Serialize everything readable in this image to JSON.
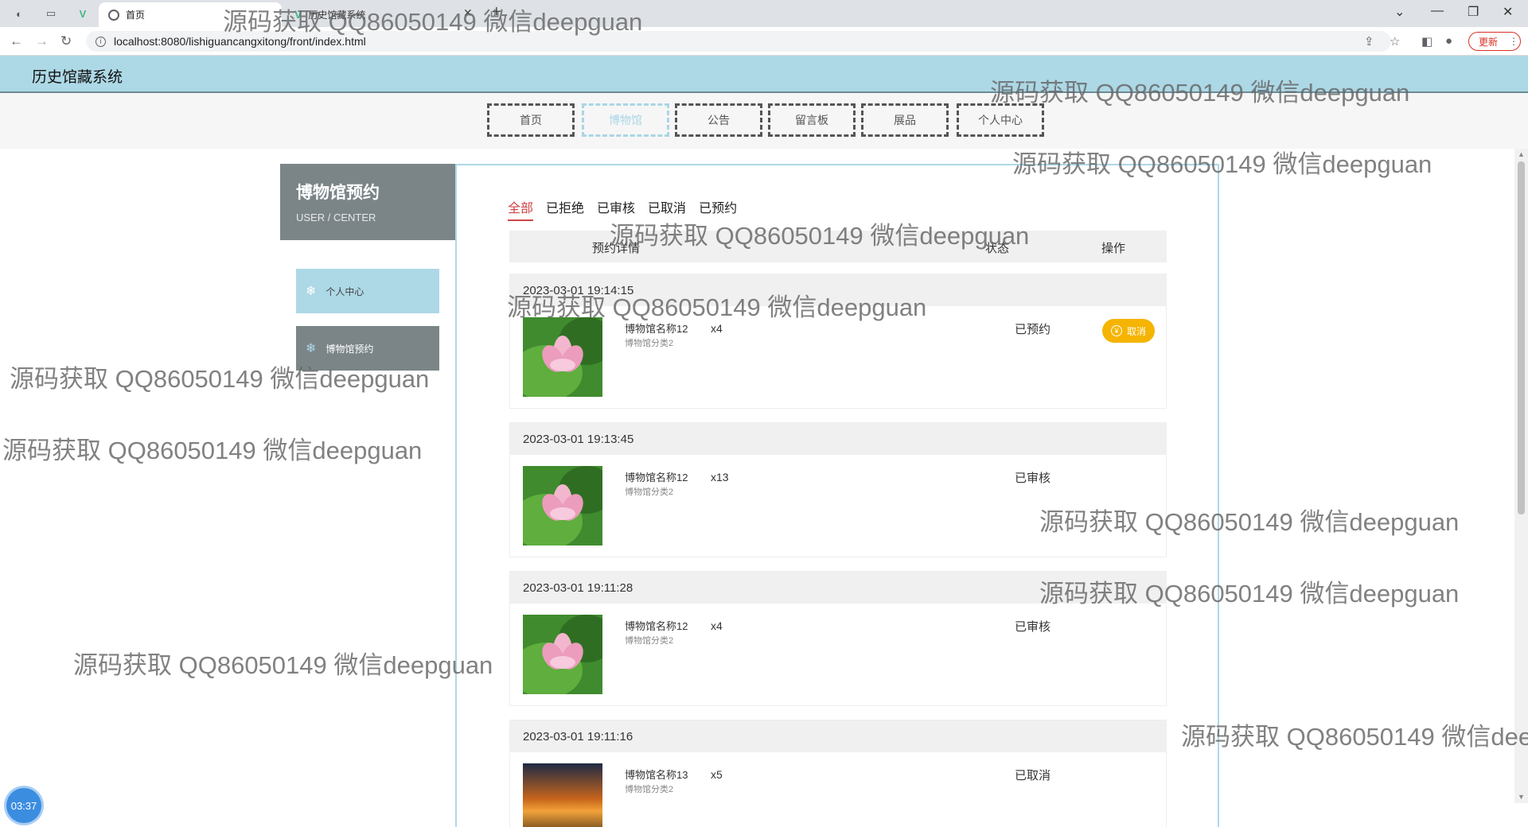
{
  "browser": {
    "tab_title": "首页",
    "tab2_title": "历史馆藏系统",
    "url": "localhost:8080/lishiguancangxitong/front/index.html",
    "update_label": "更新"
  },
  "site": {
    "title": "历史馆藏系统"
  },
  "nav": [
    "首页",
    "博物馆",
    "公告",
    "留言板",
    "展品",
    "个人中心"
  ],
  "sidebar": {
    "title": "博物馆预约",
    "subtitle": "USER / CENTER",
    "items": [
      "个人中心",
      "博物馆预约"
    ]
  },
  "filters": [
    "全部",
    "已拒绝",
    "已审核",
    "已取消",
    "已预约"
  ],
  "table_headers": {
    "detail": "预约详情",
    "status": "状态",
    "action": "操作"
  },
  "orders": [
    {
      "time": "2023-03-01 19:14:15",
      "name": "博物馆名称12",
      "category": "博物馆分类2",
      "qty": "x4",
      "status": "已预约",
      "action": "取消",
      "image": "lotus"
    },
    {
      "time": "2023-03-01 19:13:45",
      "name": "博物馆名称12",
      "category": "博物馆分类2",
      "qty": "x13",
      "status": "已审核",
      "image": "lotus"
    },
    {
      "time": "2023-03-01 19:11:28",
      "name": "博物馆名称12",
      "category": "博物馆分类2",
      "qty": "x4",
      "status": "已审核",
      "image": "lotus"
    },
    {
      "time": "2023-03-01 19:11:16",
      "name": "博物馆名称13",
      "category": "博物馆分类2",
      "qty": "x5",
      "status": "已取消",
      "image": "sunset"
    }
  ],
  "timer": "03:37",
  "watermark": "源码获取 QQ86050149 微信deepguan",
  "colors": {
    "header": "#add8e6",
    "side_dark": "#7b8588",
    "cancel": "#f5b400",
    "filter_active": "#cc4444"
  }
}
